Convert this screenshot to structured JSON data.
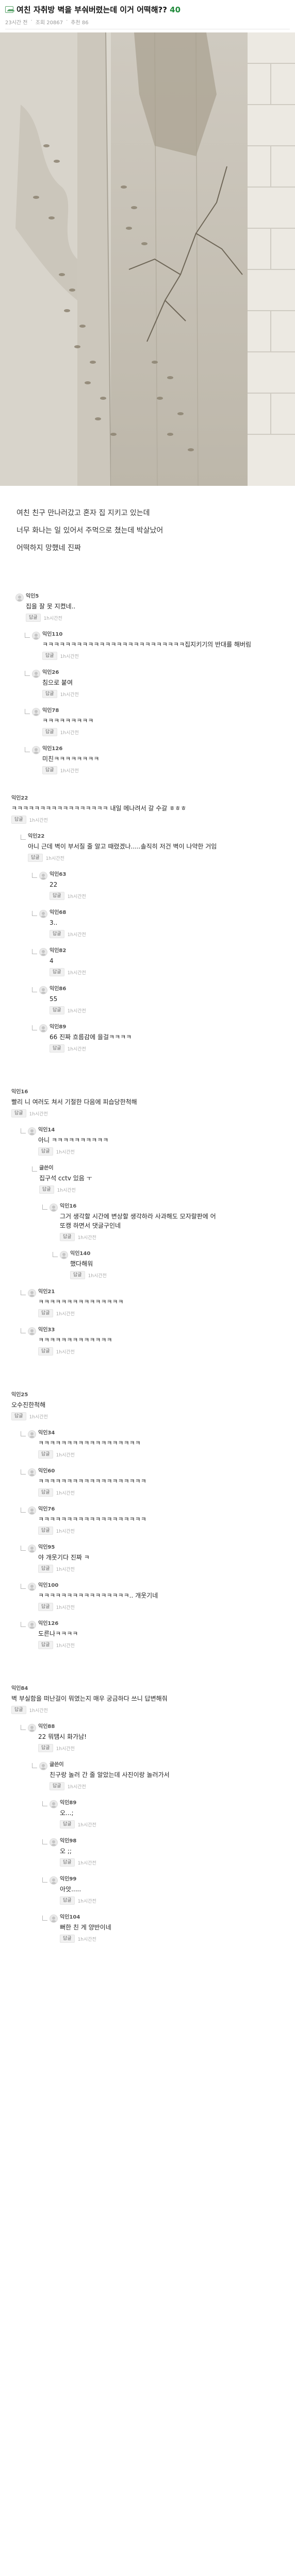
{
  "post": {
    "title_main": "여친 자취방 벽을 부숴버렸는데 이거 어떡해?? ",
    "comment_count": "40",
    "meta_date": "23시간 전",
    "meta_views": "조회 20867",
    "meta_recommend": "추천 86",
    "body_lines": [
      "여친 친구 만나러갔고 혼자 집 지키고 있는데",
      "너무 화나는 일 있어서 주먹으로 쳤는데 박살났어",
      "어떡하지 망했네 진짜"
    ]
  },
  "ui": {
    "reply_label": "답글",
    "time_label": "1h시간 전"
  },
  "comments": [
    {
      "nick": "익인5",
      "text": "집을 잘 못 지켰네..",
      "reply": true,
      "time": "1h시간전"
    },
    {
      "nick": "익인110",
      "text": "ㅋㅋㅋㅋㅋㅋㅋㅋㅋㅋㅋㅋㅋㅋㅋㅋㅋㅋㅋㅋㅋㅋㅋㅋㅋ집지키기의 반대를 해버림",
      "reply": true,
      "time": "1h시간전"
    },
    {
      "nick": "익인26",
      "text": "침으로 붙여",
      "reply": true,
      "time": "1h시간전"
    },
    {
      "nick": "익인78",
      "text": "ㅋㅋㅋㅋㅋㅋㅋㅋㅋ",
      "reply": true,
      "time": "1h시간전"
    },
    {
      "nick": "익인126",
      "text": "미친ㅋㅋㅋㅋㅋㅋㅋㅋ",
      "reply": true,
      "time": "1h시간전"
    },
    {
      "nick": "익인22",
      "text": "ㅋㅋㅋㅋㅋㅋㅋㅋㅋㅋㅋㅋㅋㅋㅋㅋㅋ 내일 메나려서 갈 수갈 ㅎㅎㅎ",
      "reply": true,
      "time": "1h시간전"
    },
    {
      "nick": "익인22",
      "text": "아니 근데 벽이 부서질 줄 알고 때렸겠나.....솔직히 저건 벽이 나약한 거임",
      "reply": true,
      "time": "1h시간전"
    },
    {
      "nick": "익인63",
      "text": "22",
      "reply": true,
      "time": "1h시간전"
    },
    {
      "nick": "익인68",
      "text": "3..",
      "reply": true,
      "time": "1h시간전"
    },
    {
      "nick": "익인82",
      "text": "4",
      "reply": true,
      "time": "1h시간전"
    },
    {
      "nick": "익인86",
      "text": "55",
      "reply": true,
      "time": "1h시간전"
    },
    {
      "nick": "익인89",
      "text": "66 진짜 흐름감에 을걸ㅋㅋㅋㅋ",
      "reply": true,
      "time": "1h시간전"
    },
    {
      "nick": "익인16",
      "text": "빨리 니 여러도 쳐서 기절한 다음에 피습당한척해",
      "reply": true,
      "time": "1h시간전"
    },
    {
      "nick": "익인14",
      "text": "아니 ㅋㅋㅋㅋㅋㅋㅋㅋㅋㅋ",
      "reply": true,
      "time": "1h시간전"
    },
    {
      "nick": "글쓴이",
      "text": "집구석 cctv 있음 ㅜ",
      "reply": true,
      "time": "1h시간전"
    },
    {
      "nick": "익인16",
      "text": "그거 생각할 시간에 변상할 생각하라 사과해도 모자랄판에 어또캥 하면서 댓글구인네",
      "reply": true,
      "time": "1h시간전"
    },
    {
      "nick": "익인140",
      "text": "했다해워",
      "reply": true,
      "time": "1h시간전"
    },
    {
      "nick": "익인21",
      "text": "ㅋㅋㅋㅋㅋㅋㅋㅋㅋㅋㅋㅋㅋㅋㅋ",
      "reply": true,
      "time": "1h시간전"
    },
    {
      "nick": "익인33",
      "text": "ㅋㅋㅋㅋㅋㅋㅋㅋㅋㅋㅋㅋㅋ",
      "reply": true,
      "time": "1h시간전"
    },
    {
      "nick": "익인25",
      "text": "오수진한척해",
      "reply": true,
      "time": "1h시간전"
    },
    {
      "nick": "익인34",
      "text": "ㅋㅋㅋㅋㅋㅋㅋㅋㅋㅋㅋㅋㅋㅋㅋㅋㅋㅋ",
      "reply": true,
      "time": "1h시간전"
    },
    {
      "nick": "익인60",
      "text": "ㅋㅋㅋㅋㅋㅋㅋㅋㅋㅋㅋㅋㅋㅋㅋㅋㅋㅋㅋ",
      "reply": true,
      "time": "1h시간전"
    },
    {
      "nick": "익인76",
      "text": "ㅋㅋㅋㅋㅋㅋㅋㅋㅋㅋㅋㅋㅋㅋㅋㅋㅋㅋㅋ",
      "reply": true,
      "time": "1h시간전"
    },
    {
      "nick": "익인95",
      "text": "야 개웃기다 진짜 ㅋ",
      "reply": true,
      "time": "1h시간전"
    },
    {
      "nick": "익인100",
      "text": "ㅋㅋㅋㅋㅋㅋㅋㅋㅋㅋㅋㅋㅋㅋㅋㅋ.. 개웃기네",
      "reply": true,
      "time": "1h시간전"
    },
    {
      "nick": "익인126",
      "text": "도른나ㅋㅋㅋㅋ",
      "reply": true,
      "time": "1h시간전"
    },
    {
      "nick": "익인84",
      "text": "벽 부실함을 떠난걸이 뭐였는지 매우 궁금하다 쓰니 답변해줘",
      "reply": true,
      "time": "1h시간전"
    },
    {
      "nick": "익인88",
      "text": "22 뭐땜시 화가남!",
      "reply": true,
      "time": "1h시간전"
    },
    {
      "nick": "글쓴이",
      "text": "친구랑 놀러 간 줄 알았는데 사진이랑 놀러가서",
      "reply": true,
      "time": "1h시간전"
    },
    {
      "nick": "익인89",
      "text": "오...;",
      "reply": true,
      "time": "1h시간전"
    },
    {
      "nick": "익인98",
      "text": "오 ;;",
      "reply": true,
      "time": "1h시간전"
    },
    {
      "nick": "익인99",
      "text": "아앗.....",
      "reply": true,
      "time": "1h시간전"
    },
    {
      "nick": "익인104",
      "text": "뻐한 친 게 양반이네",
      "reply": true,
      "time": "1h시간전"
    }
  ]
}
